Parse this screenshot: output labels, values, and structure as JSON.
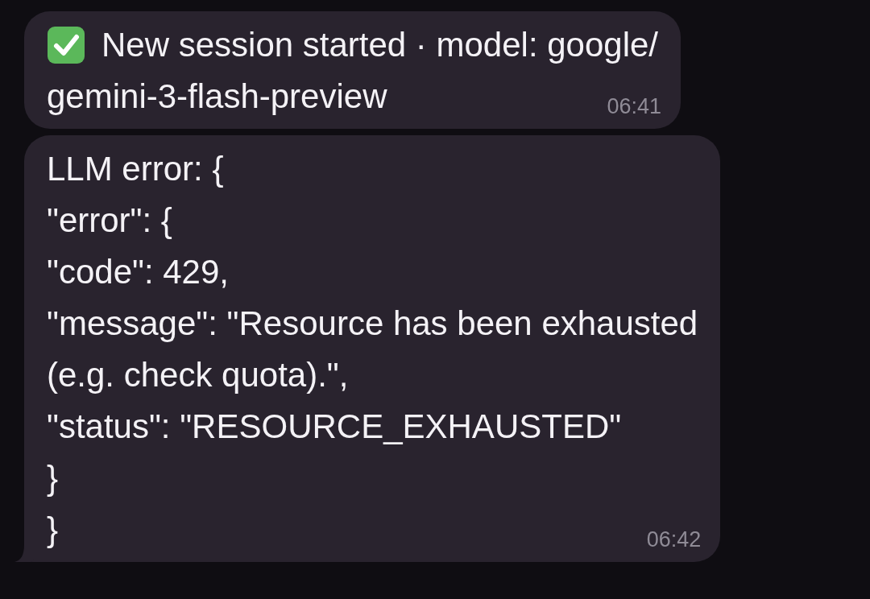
{
  "messages": [
    {
      "kind": "service",
      "lines": [
        "New session started · model: google/",
        "gemini-3-flash-preview"
      ],
      "time": "06:41",
      "tail": false
    },
    {
      "kind": "plain",
      "lines": [
        "LLM error: {",
        "\"error\": {",
        "\"code\": 429,",
        "\"message\": \"Resource has been exhausted",
        "(e.g. check quota).\",",
        "\"status\": \"RESOURCE_EXHAUSTED\"",
        "}",
        "}"
      ],
      "time": "06:42",
      "tail": true
    }
  ]
}
